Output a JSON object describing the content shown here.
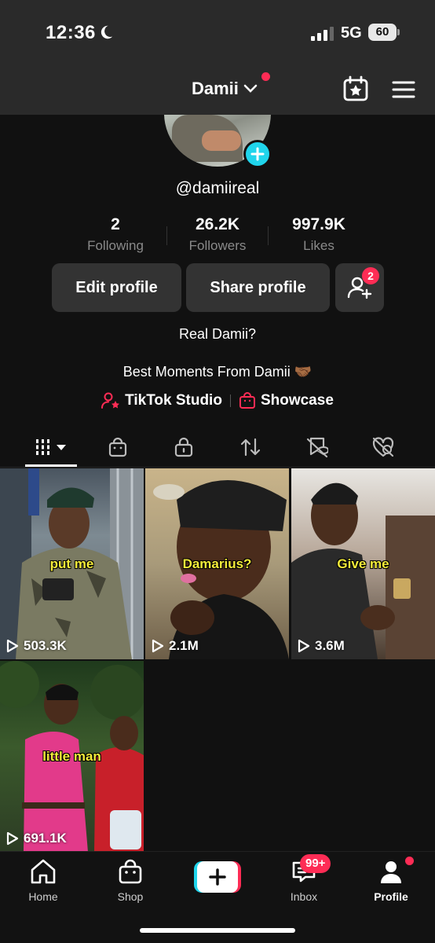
{
  "status_bar": {
    "time": "12:36",
    "network": "5G",
    "battery": "60"
  },
  "header": {
    "username": "Damii"
  },
  "profile": {
    "handle": "@damiireal",
    "stats": [
      {
        "value": "2",
        "label": "Following"
      },
      {
        "value": "26.2K",
        "label": "Followers"
      },
      {
        "value": "997.9K",
        "label": "Likes"
      }
    ],
    "edit_label": "Edit profile",
    "share_label": "Share profile",
    "add_friends_badge": "2",
    "bio_line1": "Real Damii?",
    "bio_line2": "Best Moments From Damii 🤝🏾",
    "link_studio": "TikTok Studio",
    "link_showcase": "Showcase"
  },
  "videos": [
    {
      "caption": "put me",
      "views": "503.3K"
    },
    {
      "caption": "Damarius?",
      "views": "2.1M"
    },
    {
      "caption": "Give me",
      "views": "3.6M"
    },
    {
      "caption": "little man",
      "views": "691.1K"
    }
  ],
  "nav": {
    "home": "Home",
    "shop": "Shop",
    "inbox": "Inbox",
    "inbox_badge": "99+",
    "profile": "Profile"
  },
  "colors": {
    "accent_red": "#fe2c55",
    "accent_cyan": "#20d5ec",
    "caption_yellow": "#f4ec3a"
  }
}
